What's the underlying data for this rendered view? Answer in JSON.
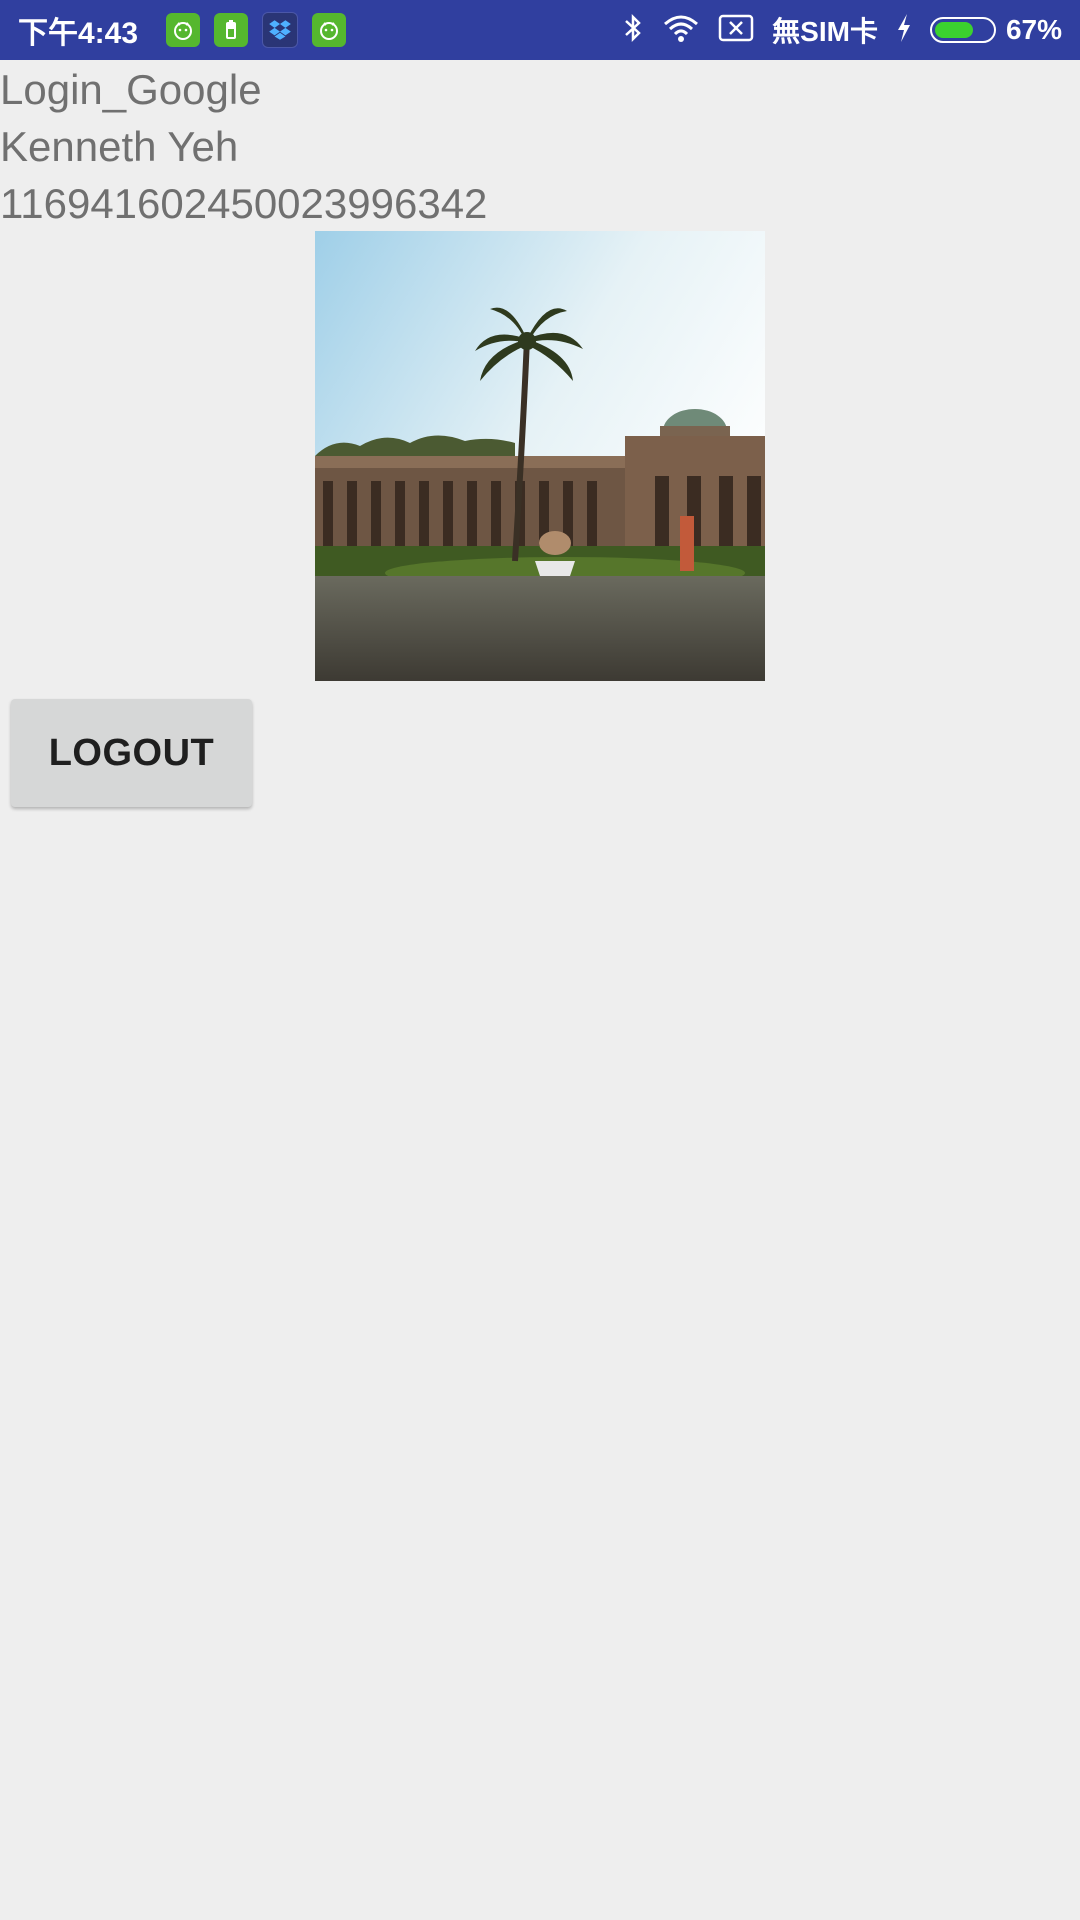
{
  "status_bar": {
    "time": "下午4:43",
    "carrier": "無SIM卡",
    "battery_percent": "67%",
    "battery_level": 0.67,
    "icons": [
      "android-icon",
      "battery-app-icon",
      "dropbox-icon",
      "android-icon",
      "bluetooth-icon",
      "wifi-icon",
      "no-sim-icon",
      "charging-icon",
      "battery-icon"
    ],
    "colors": {
      "background": "#303f9f",
      "app_icon_green": "#55b72e",
      "battery_fill": "#3bd12f"
    }
  },
  "profile": {
    "app_title": "Login_Google",
    "user_name": "Kenneth Yeh",
    "user_id": "116941602450023996342"
  },
  "actions": {
    "logout_label": "LOGOUT"
  },
  "colors": {
    "page_background": "#eeeeee",
    "text": "#707070",
    "button_background": "#d6d7d7"
  }
}
